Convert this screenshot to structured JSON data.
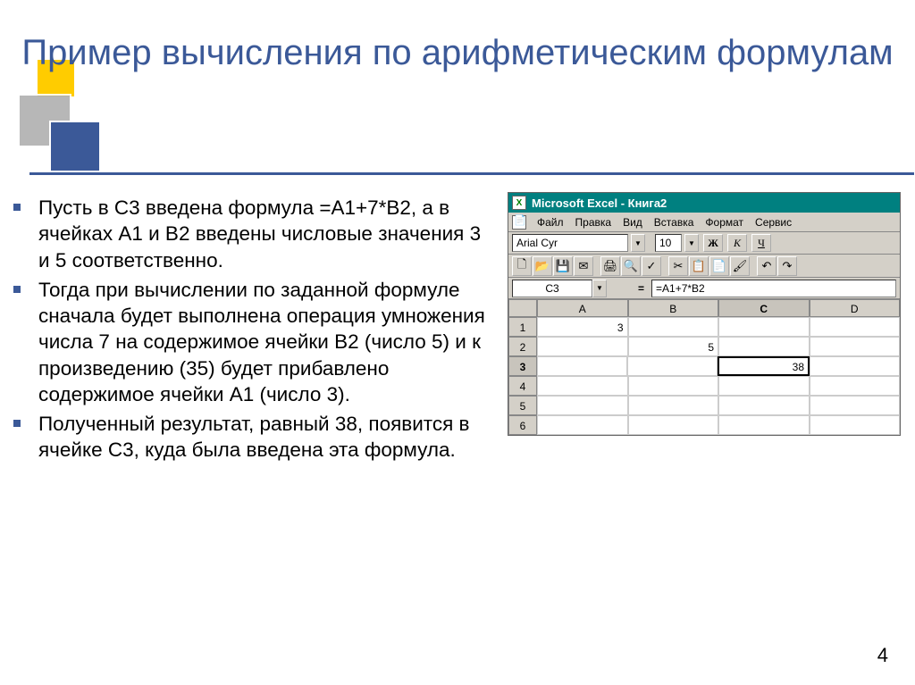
{
  "title": "Пример вычисления по арифметическим формулам",
  "bullets": [
    "Пусть в С3 введена формула =А1+7*В2, а в ячейках А1 и В2 введены числовые значения 3 и 5 соответственно.",
    "Тогда при вычислении по заданной формуле сначала будет выполнена операция умножения числа 7 на содержимое ячейки В2 (число 5) и к произведению (35) будет прибавлено содержимое ячейки А1 (число 3).",
    "Полученный результат, равный 38, появится в ячейке С3, куда была введена эта формула."
  ],
  "excel": {
    "titlebar": "Microsoft Excel - Книга2",
    "menus": {
      "file": "Файл",
      "edit": "Правка",
      "view": "Вид",
      "insert": "Вставка",
      "format": "Формат",
      "service": "Сервис"
    },
    "font": "Arial Cyr",
    "size": "10",
    "bold": "Ж",
    "italic": "К",
    "underline": "Ч",
    "namebox": "C3",
    "fx_symbol": "=",
    "formula": "=A1+7*B2",
    "columns": [
      "A",
      "B",
      "C",
      "D"
    ],
    "rows": [
      "1",
      "2",
      "3",
      "4",
      "5",
      "6"
    ],
    "cells": {
      "A1": "3",
      "B2": "5",
      "C3": "38"
    },
    "active_col": "C",
    "active_row": "3"
  },
  "page_number": "4"
}
